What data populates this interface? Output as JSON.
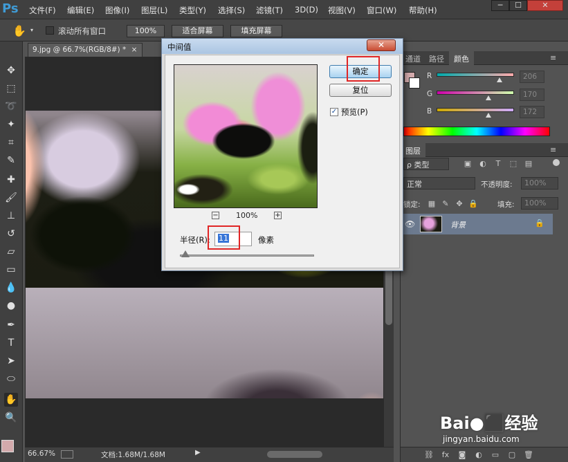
{
  "app": {
    "logo": "Ps",
    "menus": [
      "文件(F)",
      "编辑(E)",
      "图像(I)",
      "图层(L)",
      "类型(Y)",
      "选择(S)",
      "滤镜(T)",
      "3D(D)",
      "视图(V)",
      "窗口(W)",
      "帮助(H)"
    ],
    "window_buttons": [
      "─",
      "☐",
      "✕"
    ]
  },
  "options_bar": {
    "scroll_all_label": "滚动所有窗口",
    "zoom_100_label": "100%",
    "fit_screen_label": "适合屏幕",
    "fill_screen_label": "填充屏幕"
  },
  "document": {
    "tab_title": "9.jpg @ 66.7%(RGB/8#) *",
    "tab_close": "×"
  },
  "status_bar": {
    "zoom": "66.67%",
    "doc_info": "文档:1.68M/1.68M"
  },
  "right_panel": {
    "top_tabs": [
      "通道",
      "路径",
      "颜色"
    ],
    "color": {
      "swatch_fg": "#d3aaac",
      "channels": [
        {
          "label": "R",
          "value": "206",
          "fraction": 0.81
        },
        {
          "label": "G",
          "value": "170",
          "fraction": 0.67
        },
        {
          "label": "B",
          "value": "172",
          "fraction": 0.67
        }
      ]
    },
    "layers": {
      "tab_label": "图层",
      "filter_label": "ρ 类型",
      "blend_mode": "正常",
      "opacity_label": "不透明度:",
      "opacity_value": "100%",
      "lock_label": "锁定:",
      "fill_label": "填充:",
      "fill_value": "100%",
      "layer_name": "背景"
    }
  },
  "dialog": {
    "title": "中间值",
    "close_label": "✕",
    "ok_label": "确定",
    "reset_label": "复位",
    "preview_label": "预览(P)",
    "preview_checked": true,
    "zoom_out_label": "−",
    "zoom_label": "100%",
    "zoom_in_label": "+",
    "radius_label": "半径(R):",
    "radius_value": "11",
    "radius_unit": "像素"
  },
  "watermark": {
    "brand": "Bai●⬛经验",
    "url": "jingyan.baidu.com"
  }
}
